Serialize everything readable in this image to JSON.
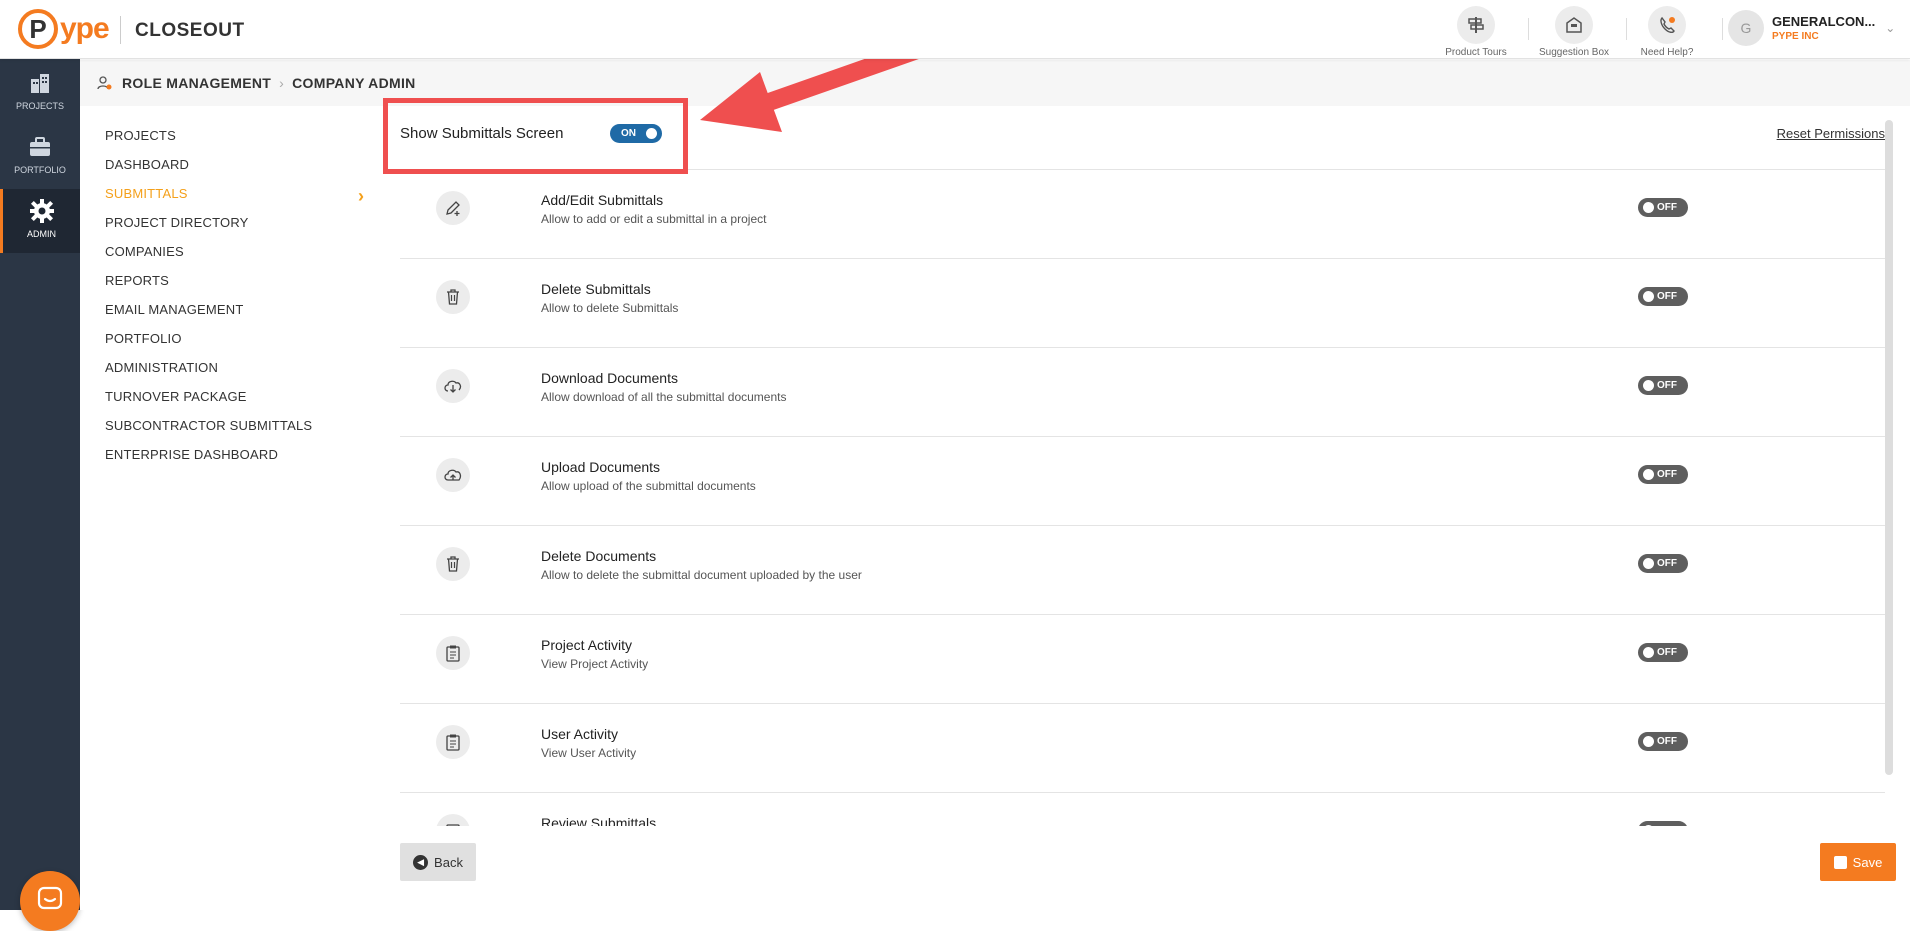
{
  "app": {
    "logo_letter": "P",
    "logo_text": "ype",
    "product": "CLOSEOUT"
  },
  "top_actions": [
    {
      "label": "Product Tours",
      "icon": "signpost-icon"
    },
    {
      "label": "Suggestion Box",
      "icon": "suggestion-box-icon"
    },
    {
      "label": "Need Help?",
      "icon": "phone-help-icon"
    }
  ],
  "user": {
    "initial": "G",
    "name": "GENERALCON...",
    "company": "PYPE INC"
  },
  "sidenav": [
    {
      "label": "PROJECTS",
      "icon": "building-icon"
    },
    {
      "label": "PORTFOLIO",
      "icon": "briefcase-icon"
    },
    {
      "label": "ADMIN",
      "icon": "gear-icon"
    }
  ],
  "breadcrumb": [
    "ROLE MANAGEMENT",
    "COMPANY ADMIN"
  ],
  "menu": [
    "PROJECTS",
    "DASHBOARD",
    "SUBMITTALS",
    "PROJECT DIRECTORY",
    "COMPANIES",
    "REPORTS",
    "EMAIL MANAGEMENT",
    "PORTFOLIO",
    "ADMINISTRATION",
    "TURNOVER PACKAGE",
    "SUBCONTRACTOR SUBMITTALS",
    "ENTERPRISE DASHBOARD"
  ],
  "active_menu": "SUBMITTALS",
  "screen_toggle": {
    "label": "Show Submittals Screen",
    "state": "ON"
  },
  "reset_label": "Reset Permissions",
  "permissions": [
    {
      "title": "Add/Edit Submittals",
      "desc": "Allow to add or edit a submittal in a project",
      "icon": "pencil-plus-icon",
      "state": "OFF"
    },
    {
      "title": "Delete Submittals",
      "desc": "Allow to delete Submittals",
      "icon": "trash-icon",
      "state": "OFF"
    },
    {
      "title": "Download Documents",
      "desc": "Allow download of all the submittal documents",
      "icon": "cloud-download-icon",
      "state": "OFF"
    },
    {
      "title": "Upload Documents",
      "desc": "Allow upload of the submittal documents",
      "icon": "cloud-upload-icon",
      "state": "OFF"
    },
    {
      "title": "Delete Documents",
      "desc": "Allow to delete the submittal document uploaded by the user",
      "icon": "trash-icon",
      "state": "OFF"
    },
    {
      "title": "Project Activity",
      "desc": "View Project Activity",
      "icon": "clipboard-icon",
      "state": "OFF"
    },
    {
      "title": "User Activity",
      "desc": "View User Activity",
      "icon": "clipboard-icon",
      "state": "OFF"
    },
    {
      "title": "Review Submittals",
      "desc": "",
      "icon": "review-icon",
      "state": "OFF"
    }
  ],
  "footer": {
    "back_label": "Back",
    "save_label": "Save"
  },
  "colors": {
    "accent": "#f47b20",
    "sidenav": "#2b3645",
    "toggle_on": "#1f6aa6",
    "toggle_off": "#5e5e5e",
    "annotation": "#ef4f4f"
  }
}
